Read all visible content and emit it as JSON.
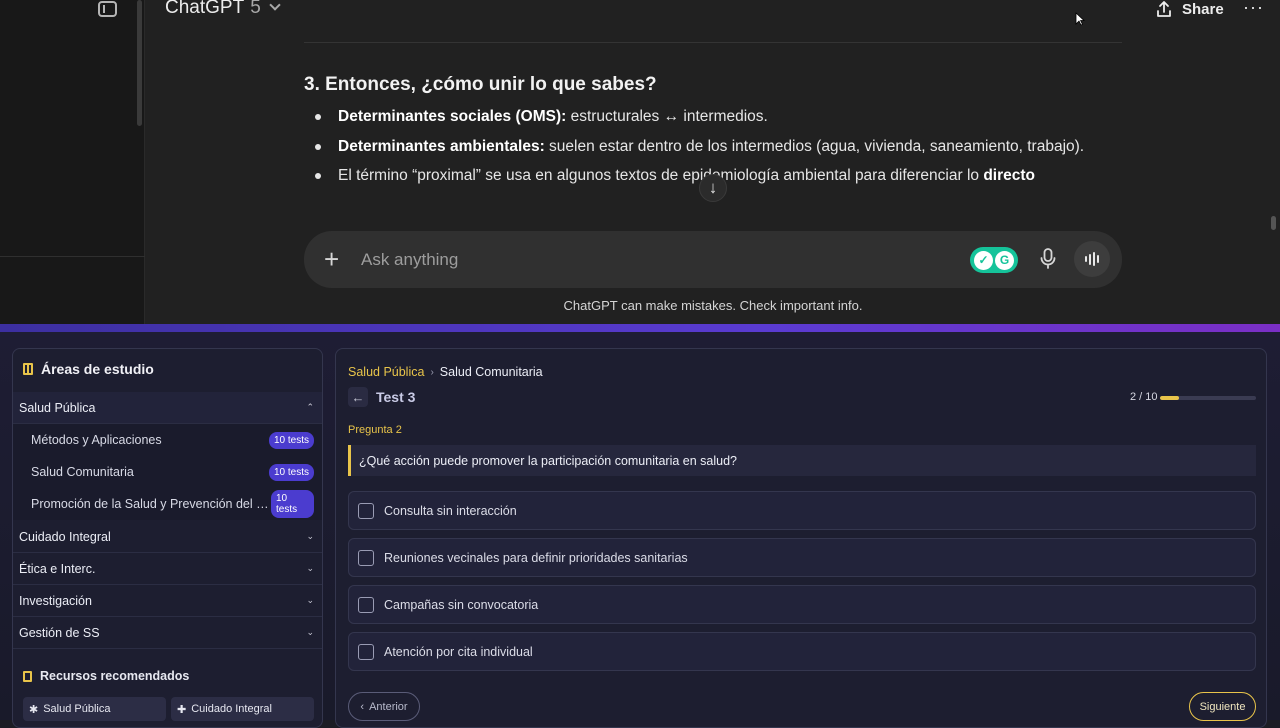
{
  "chat": {
    "model_name": "ChatGPT",
    "model_version": "5",
    "share_label": "Share",
    "more_label": "···",
    "answer": {
      "heading": "3. Entonces, ¿cómo unir lo que sabes?",
      "bullets": [
        {
          "bold": "Determinantes sociales (OMS):",
          "text": " estructurales ↔ intermedios."
        },
        {
          "bold": "Determinantes ambientales:",
          "text": " suelen estar dentro de los intermedios (agua, vivienda, saneamiento, trabajo)."
        },
        {
          "text": "El término “proximal” se usa en algunos textos de epidemiología ambiental para diferenciar lo ",
          "bold_end": "directo"
        }
      ]
    },
    "composer_placeholder": "Ask anything",
    "disclaimer": "ChatGPT can make mistakes. Check important info."
  },
  "study": {
    "areas_title": "Áreas de estudio",
    "areas": [
      {
        "label": "Salud Pública",
        "caret": "⌃",
        "open": true
      },
      {
        "label": "Cuidado Integral",
        "caret": "⌄"
      },
      {
        "label": "Ética e Interc.",
        "caret": "⌄"
      },
      {
        "label": "Investigación",
        "caret": "⌄"
      },
      {
        "label": "Gestión de SS",
        "caret": "⌄"
      }
    ],
    "subareas": [
      {
        "label": "Métodos y Aplicaciones",
        "badge": "10 tests"
      },
      {
        "label": "Salud Comunitaria",
        "badge": "10 tests"
      },
      {
        "label": "Promoción de la Salud y Prevención del ries...",
        "badge": "10 tests"
      }
    ],
    "resources_title": "Recursos recomendados",
    "resources": [
      {
        "icon": "✱",
        "label": "Salud Pública"
      },
      {
        "icon": "✚",
        "label": "Cuidado Integral"
      }
    ],
    "breadcrumb": {
      "parent": "Salud Pública",
      "sep": "›",
      "current": "Salud Comunitaria"
    },
    "back_icon": "←",
    "test_name": "Test 3",
    "progress_text": "2 / 10",
    "progress_value": 0.2,
    "question_label": "Pregunta 2",
    "question": "¿Qué acción puede promover la participación comunitaria en salud?",
    "options": [
      "Consulta sin interacción",
      "Reuniones vecinales para definir prioridades sanitarias",
      "Campañas sin convocatoria",
      "Atención por cita individual"
    ],
    "prev_label": "Anterior",
    "prev_icon": "‹",
    "next_label": "Siguiente",
    "accent": "#e8c44a"
  }
}
